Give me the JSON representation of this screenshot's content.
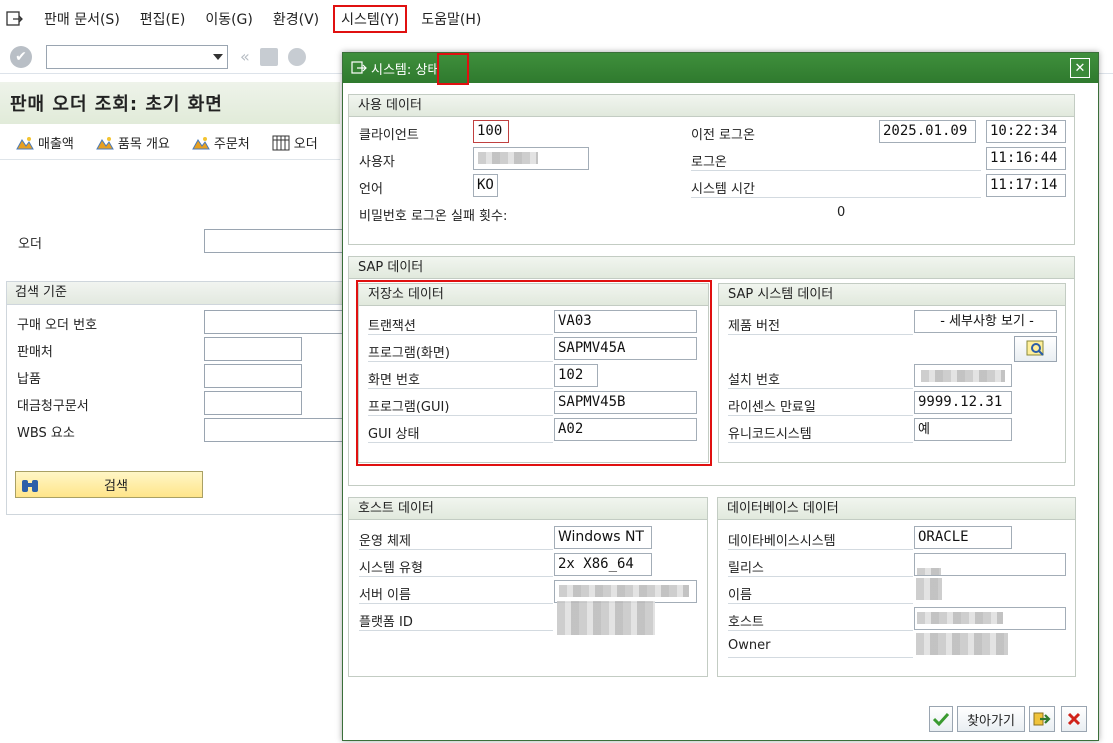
{
  "menu": {
    "items": [
      "판매 문서(S)",
      "편집(E)",
      "이동(G)",
      "환경(V)",
      "시스템(Y)",
      "도움말(H)"
    ]
  },
  "title": "판매 오더 조회: 초기 화면",
  "app_toolbar": {
    "buttons": [
      "매출액",
      "품목 개요",
      "주문처",
      "오더"
    ]
  },
  "form": {
    "order_label": "오더",
    "search_group": "검색 기준",
    "fields": [
      "구매 오더 번호",
      "판매처",
      "납품",
      "대금청구문서",
      "WBS 요소"
    ],
    "search_button": "검색"
  },
  "dialog": {
    "title": "시스템: 상태",
    "usage": {
      "header": "사용 데이터",
      "client_label": "클라이언트",
      "client_value": "100",
      "user_label": "사용자",
      "language_label": "언어",
      "language_value": "KO",
      "failed_logons_label": "비밀번호 로그온 실패 횟수:",
      "failed_logons_value": "0",
      "prev_logon_label": "이전 로그온",
      "prev_logon_date": "2025.01.09",
      "prev_logon_time": "10:22:34",
      "logon_label": "로그온",
      "logon_time": "11:16:44",
      "system_time_label": "시스템 시간",
      "system_time": "11:17:14"
    },
    "sap": {
      "header": "SAP 데이터",
      "repo": {
        "header": "저장소 데이터",
        "transaction_label": "트랜잭션",
        "transaction_value": "VA03",
        "program_screen_label": "프로그램(화면)",
        "program_screen_value": "SAPMV45A",
        "screen_no_label": "화면 번호",
        "screen_no_value": "102",
        "program_gui_label": "프로그램(GUI)",
        "program_gui_value": "SAPMV45B",
        "gui_status_label": "GUI 상태",
        "gui_status_value": "A02"
      },
      "system": {
        "header": "SAP 시스템 데이터",
        "product_version_label": "제품 버전",
        "product_version_value": "- 세부사항 보기 -",
        "install_no_label": "설치 번호",
        "license_label": "라이센스 만료일",
        "license_value": "9999.12.31",
        "unicode_label": "유니코드시스템",
        "unicode_value": "예"
      }
    },
    "host": {
      "header": "호스트 데이터",
      "os_label": "운영 체제",
      "os_value": "Windows NT",
      "system_type_label": "시스템 유형",
      "system_type_value": "2x X86_64",
      "server_label": "서버 이름",
      "platform_label": "플랫폼 ID"
    },
    "db": {
      "header": "데이터베이스 데이터",
      "db_system_label": "데이타베이스시스템",
      "db_system_value": "ORACLE",
      "release_label": "릴리스",
      "name_label": "이름",
      "host_label": "호스트",
      "owner_label": "Owner"
    },
    "footer": {
      "navigate_label": "찾아가기"
    }
  },
  "colors": {
    "dialog_title_bg": "#2f7a2e",
    "highlight": "#e01010",
    "search_button_bg": "#ffe58a"
  }
}
